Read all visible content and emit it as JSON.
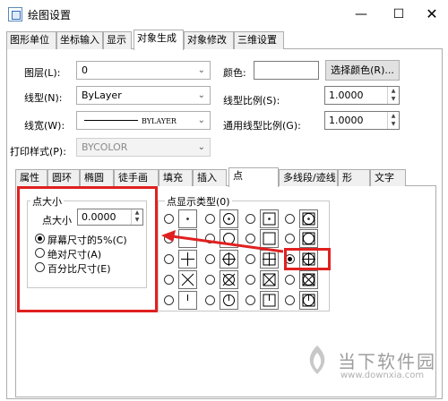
{
  "window": {
    "title": "绘图设置",
    "minimize": "—",
    "maximize": "☐",
    "close": "✕"
  },
  "main_tabs": [
    "图形单位",
    "坐标输入",
    "显示",
    "对象生成",
    "对象修改",
    "三维设置"
  ],
  "form": {
    "layer_label": "图层(L):",
    "layer_value": "0",
    "color_label": "颜色:",
    "color_value": "",
    "select_color_btn": "选择颜色(R)...",
    "linetype_label": "线型(N):",
    "linetype_value": "ByLayer",
    "ltscale_label": "线型比例(S):",
    "ltscale_value": "1.0000",
    "lineweight_label": "线宽(W):",
    "lineweight_value": "BYLAYER",
    "global_ltscale_label": "通用线型比例(G):",
    "global_ltscale_value": "1.0000",
    "plotstyle_label": "打印样式(P):",
    "plotstyle_value": "BYCOLOR"
  },
  "sub_tabs": [
    "属性",
    "圆环",
    "椭圆",
    "徒手画",
    "填充",
    "插入",
    "点",
    "多线段/迹线",
    "形",
    "文字"
  ],
  "point_size": {
    "group_title": "点大小",
    "size_label": "点大小",
    "size_value": "0.0000",
    "opt_screen": "屏幕尺寸的5%(C)",
    "opt_absolute": "绝对尺寸(A)",
    "opt_percent": "百分比尺寸(E)"
  },
  "point_display": {
    "title": "点显示类型(0)",
    "selected_row": 2,
    "selected_col": 3
  },
  "colors": {
    "highlight": "#e02020"
  },
  "watermark": {
    "text": "当下软件园",
    "url": "www.downxia.com"
  }
}
